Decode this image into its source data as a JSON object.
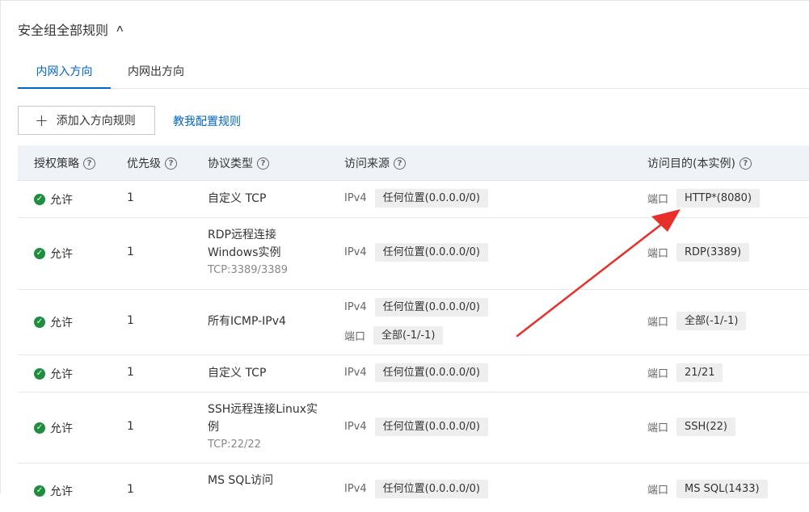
{
  "section": {
    "title": "安全组全部规则"
  },
  "tabs": [
    {
      "label": "内网入方向",
      "active": true
    },
    {
      "label": "内网出方向",
      "active": false
    }
  ],
  "toolbar": {
    "add_label": "添加入方向规则",
    "guide_label": "教我配置规则"
  },
  "columns": [
    "授权策略",
    "优先级",
    "协议类型",
    "访问来源",
    "访问目的(本实例)"
  ],
  "rows": [
    {
      "policy": "允许",
      "priority": "1",
      "protocol": [
        "自定义 TCP"
      ],
      "protocol_sub": "",
      "source": [
        {
          "k": "IPv4",
          "v": "任何位置(0.0.0.0/0)"
        }
      ],
      "dest_k": "端口",
      "dest_v": "HTTP*(8080)"
    },
    {
      "policy": "允许",
      "priority": "1",
      "protocol": [
        "RDP远程连接",
        "Windows实例"
      ],
      "protocol_sub": "TCP:3389/3389",
      "source": [
        {
          "k": "IPv4",
          "v": "任何位置(0.0.0.0/0)"
        }
      ],
      "dest_k": "端口",
      "dest_v": "RDP(3389)"
    },
    {
      "policy": "允许",
      "priority": "1",
      "protocol": [
        "所有ICMP-IPv4"
      ],
      "protocol_sub": "",
      "source": [
        {
          "k": "IPv4",
          "v": "任何位置(0.0.0.0/0)"
        },
        {
          "k": "端口",
          "v": "全部(-1/-1)"
        }
      ],
      "dest_k": "端口",
      "dest_v": "全部(-1/-1)"
    },
    {
      "policy": "允许",
      "priority": "1",
      "protocol": [
        "自定义 TCP"
      ],
      "protocol_sub": "",
      "source": [
        {
          "k": "IPv4",
          "v": "任何位置(0.0.0.0/0)"
        }
      ],
      "dest_k": "端口",
      "dest_v": "21/21"
    },
    {
      "policy": "允许",
      "priority": "1",
      "protocol": [
        "SSH远程连接Linux实",
        "例"
      ],
      "protocol_sub": "TCP:22/22",
      "source": [
        {
          "k": "IPv4",
          "v": "任何位置(0.0.0.0/0)"
        }
      ],
      "dest_k": "端口",
      "dest_v": "SSH(22)"
    },
    {
      "policy": "允许",
      "priority": "1",
      "protocol": [
        "MS SQL访问"
      ],
      "protocol_sub": "",
      "source": [
        {
          "k": "IPv4",
          "v": "任何位置(0.0.0.0/0)"
        }
      ],
      "dest_k": "端口",
      "dest_v": "MS SQL(1433)"
    }
  ],
  "annotation": {
    "color": "#e8302a"
  },
  "colors": {
    "accent": "#0064c8",
    "allow": "#1e8e3e"
  }
}
